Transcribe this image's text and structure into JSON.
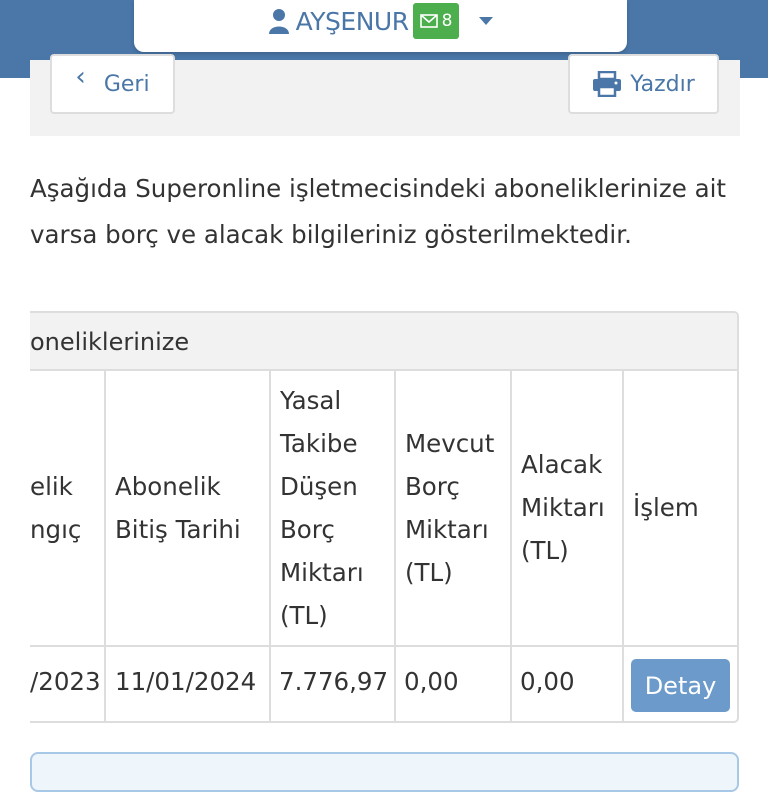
{
  "header": {
    "user_name": "AYŞENUR",
    "mail_count": "8"
  },
  "toolbar": {
    "back_label": "Geri",
    "print_label": "Yazdır"
  },
  "intro_text": "Aşağıda Superonline işletmecisindeki aboneliklerinize ait varsa borç ve alacak bilgileriniz gösterilmektedir.",
  "panel": {
    "title": "oneliklerinize",
    "columns": {
      "start_line1": "elik",
      "start_line2": "ngıç",
      "end_line1": "Abonelik",
      "end_line2": "Bitiş Tarihi",
      "legal_1": "Yasal",
      "legal_2": "Takibe",
      "legal_3": "Düşen",
      "legal_4": "Borç",
      "legal_5": "Miktarı",
      "legal_6": "(TL)",
      "current_1": "Mevcut",
      "current_2": "Borç",
      "current_3": "Miktarı",
      "current_4": "(TL)",
      "credit_1": "Alacak",
      "credit_2": "Miktarı",
      "credit_3": "(TL)",
      "action": "İşlem"
    },
    "rows": [
      {
        "start_date": "/2023",
        "end_date": "11/01/2024",
        "legal_debt": "7.776,97",
        "current_debt": "0,00",
        "credit": "0,00",
        "action_label": "Detay"
      }
    ]
  },
  "colors": {
    "header_blue": "#4a77a8",
    "badge_green": "#4cae4c",
    "detail_button": "#6b9acb"
  }
}
